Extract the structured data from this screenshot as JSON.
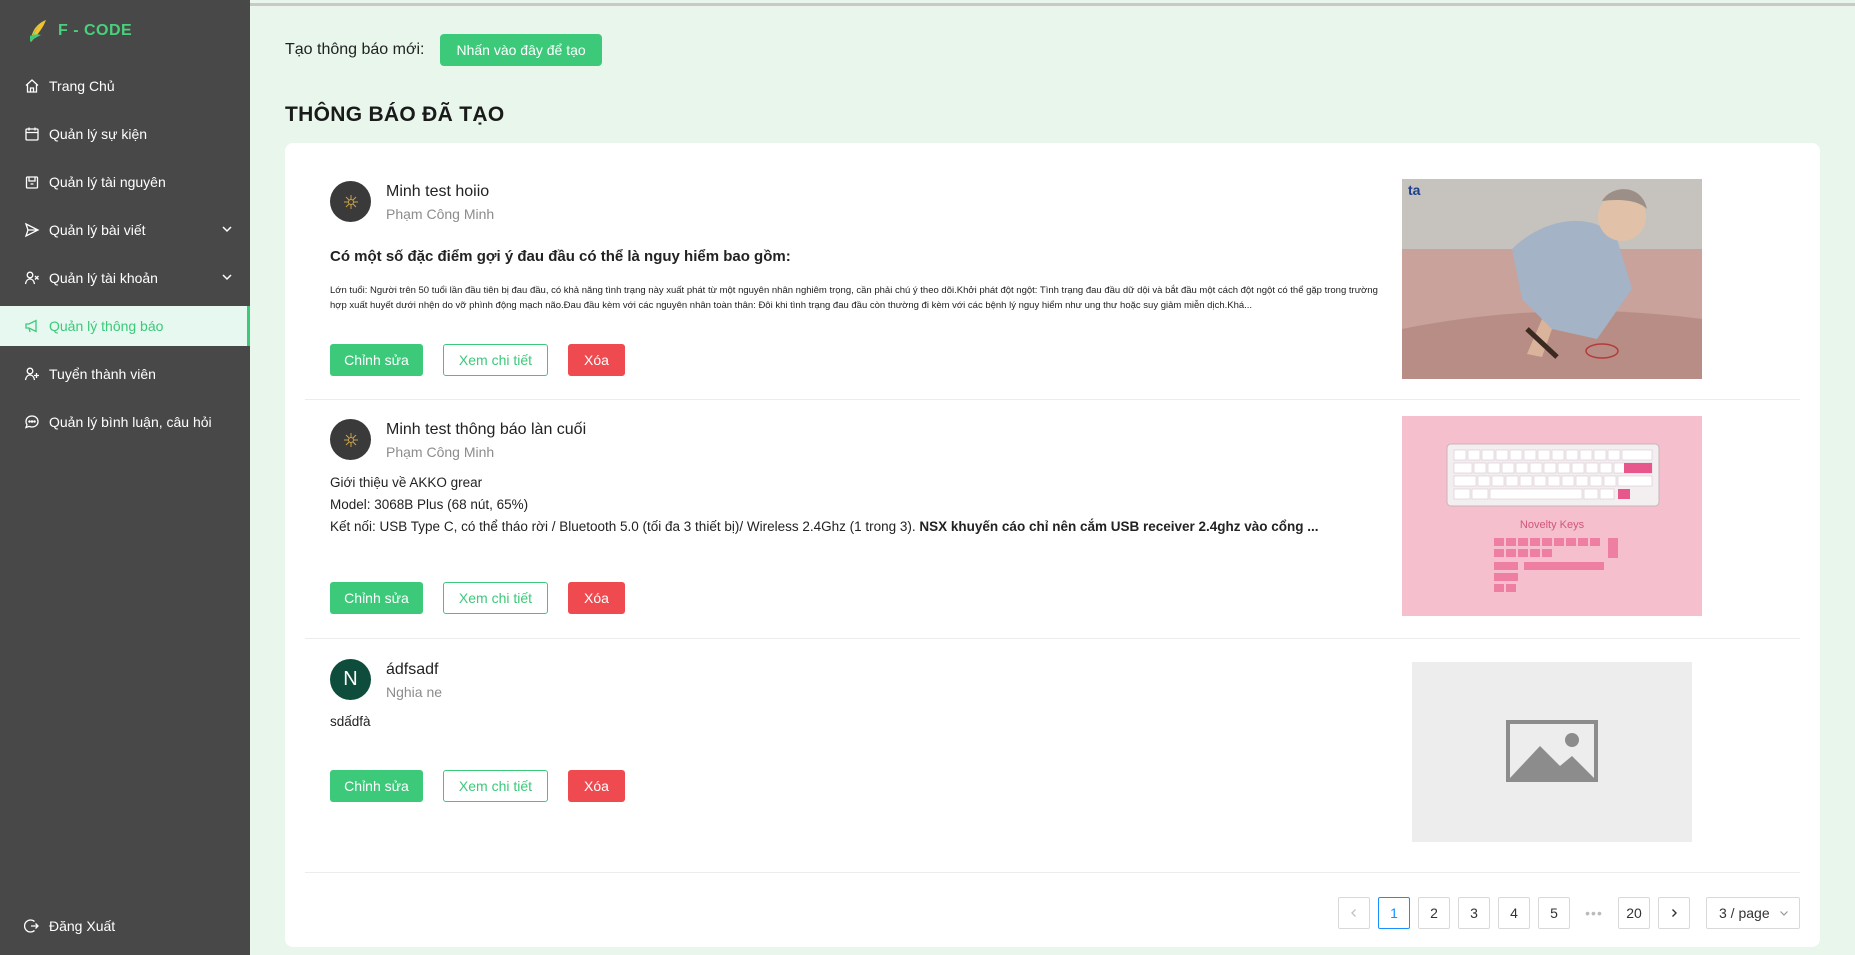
{
  "app": {
    "logo_text": "F - CODE",
    "brand_color": "#3cc97a"
  },
  "sidebar": {
    "items": [
      {
        "label": "Trang Chủ",
        "icon": "home-icon"
      },
      {
        "label": "Quản lý sự kiện",
        "icon": "calendar-icon"
      },
      {
        "label": "Quản lý tài nguyên",
        "icon": "folder-icon"
      },
      {
        "label": "Quản lý bài viết",
        "icon": "send-icon",
        "expandable": true
      },
      {
        "label": "Quản lý tài khoản",
        "icon": "users-icon",
        "expandable": true
      },
      {
        "label": "Quản lý thông báo",
        "icon": "megaphone-icon",
        "active": true
      },
      {
        "label": "Tuyển thành viên",
        "icon": "user-plus-icon"
      },
      {
        "label": "Quản lý bình luận, câu hỏi",
        "icon": "comment-icon"
      }
    ],
    "logout_label": "Đăng Xuất"
  },
  "header": {
    "create_label": "Tạo thông báo mới:",
    "create_button": "Nhấn vào đây để tạo",
    "section_title": "THÔNG BÁO ĐÃ TẠO"
  },
  "notifications": [
    {
      "title": "Minh test hoiio",
      "author": "Phạm Công Minh",
      "avatar": "dark-logo",
      "lead": "Có một số đặc điểm gợi ý đau đầu có thể là nguy hiểm bao gồm:",
      "body": "Lớn tuổi: Người trên 50 tuổi lần đầu tiên bị đau đầu, có khả năng tình trạng này xuất phát từ một nguyên nhân nghiêm trọng, cần phải chú ý theo dõi.Khởi phát đột ngột: Tình trạng đau đầu dữ dội và bắt đầu một cách đột ngột có thể gặp trong trường hợp xuất huyết dưới nhện do vỡ phình động mạch não.Đau đầu kèm với các nguyên nhân toàn thân: Đôi khi tình trạng đau đầu còn thường đi kèm với các bệnh lý nguy hiểm như ung thư hoặc suy giảm miễn dịch.Khá...",
      "image_label": "ta"
    },
    {
      "title": "Minh test thông báo làn cuối",
      "author": "Phạm Công Minh",
      "avatar": "dark-logo",
      "lines": [
        "Giới thiệu về AKKO grear",
        "Model: 3068B Plus (68 nút, 65%)"
      ],
      "line3_normal": "Kết nối: USB Type C, có thể tháo rời / Bluetooth 5.0 (tối đa 3 thiết bị)/ Wireless 2.4Ghz (1 trong 3). ",
      "line3_bold": "NSX khuyến cáo chỉ nên cắm USB receiver 2.4ghz vào cổng ...",
      "image_label": "Novelty Keys"
    },
    {
      "title": "ádfsadf",
      "author": "Nghia ne",
      "avatar_letter": "N",
      "body": "sdấdfà",
      "image": "placeholder"
    }
  ],
  "actions": {
    "edit": "Chỉnh sửa",
    "view": "Xem chi tiết",
    "delete": "Xóa"
  },
  "pagination": {
    "pages": [
      "1",
      "2",
      "3",
      "4",
      "5"
    ],
    "current": "1",
    "ellipsis": "•••",
    "last": "20",
    "page_size": "3 / page"
  }
}
